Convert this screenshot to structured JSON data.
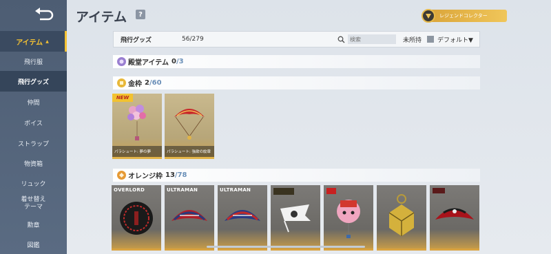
{
  "header": {
    "title": "アイテム",
    "help": "?",
    "collector": "レジェンドコレクター"
  },
  "sidebar": {
    "items": [
      {
        "label": "アイテム"
      },
      {
        "label": "飛行服"
      },
      {
        "label": "飛行グッズ"
      },
      {
        "label": "仲間"
      },
      {
        "label": "ボイス"
      },
      {
        "label": "ストラップ"
      },
      {
        "label": "物資箱"
      },
      {
        "label": "リュック"
      },
      {
        "label": "着せ替え",
        "label2": "テーマ"
      },
      {
        "label": "勲章"
      },
      {
        "label": "図鑑"
      }
    ]
  },
  "filter": {
    "name": "飛行グッズ",
    "count": "56/279",
    "search_placeholder": "検索",
    "unowned": "未所持",
    "sort": "デフォルト"
  },
  "sections": [
    {
      "name": "殿堂アイテム",
      "owned": "0",
      "total": "/3",
      "color": "#9a7fd1"
    },
    {
      "name": "金枠",
      "owned": "2",
      "total": "/60",
      "color": "#e8b83a"
    },
    {
      "name": "オレンジ枠",
      "owned": "13",
      "total": "/78",
      "color": "#e69a35"
    }
  ],
  "gold_items": [
    {
      "label": "パラシュート: 夢の夢",
      "new": "NEW"
    },
    {
      "label": "パラシュート: 強欲の紋章"
    }
  ],
  "orange_items": [
    {
      "brand": "OVERLORD"
    },
    {
      "brand": "ULTRAMAN"
    },
    {
      "brand": "ULTRAMAN"
    },
    {
      "brand": ""
    },
    {
      "brand": ""
    },
    {
      "brand": ""
    },
    {
      "brand": ""
    }
  ]
}
